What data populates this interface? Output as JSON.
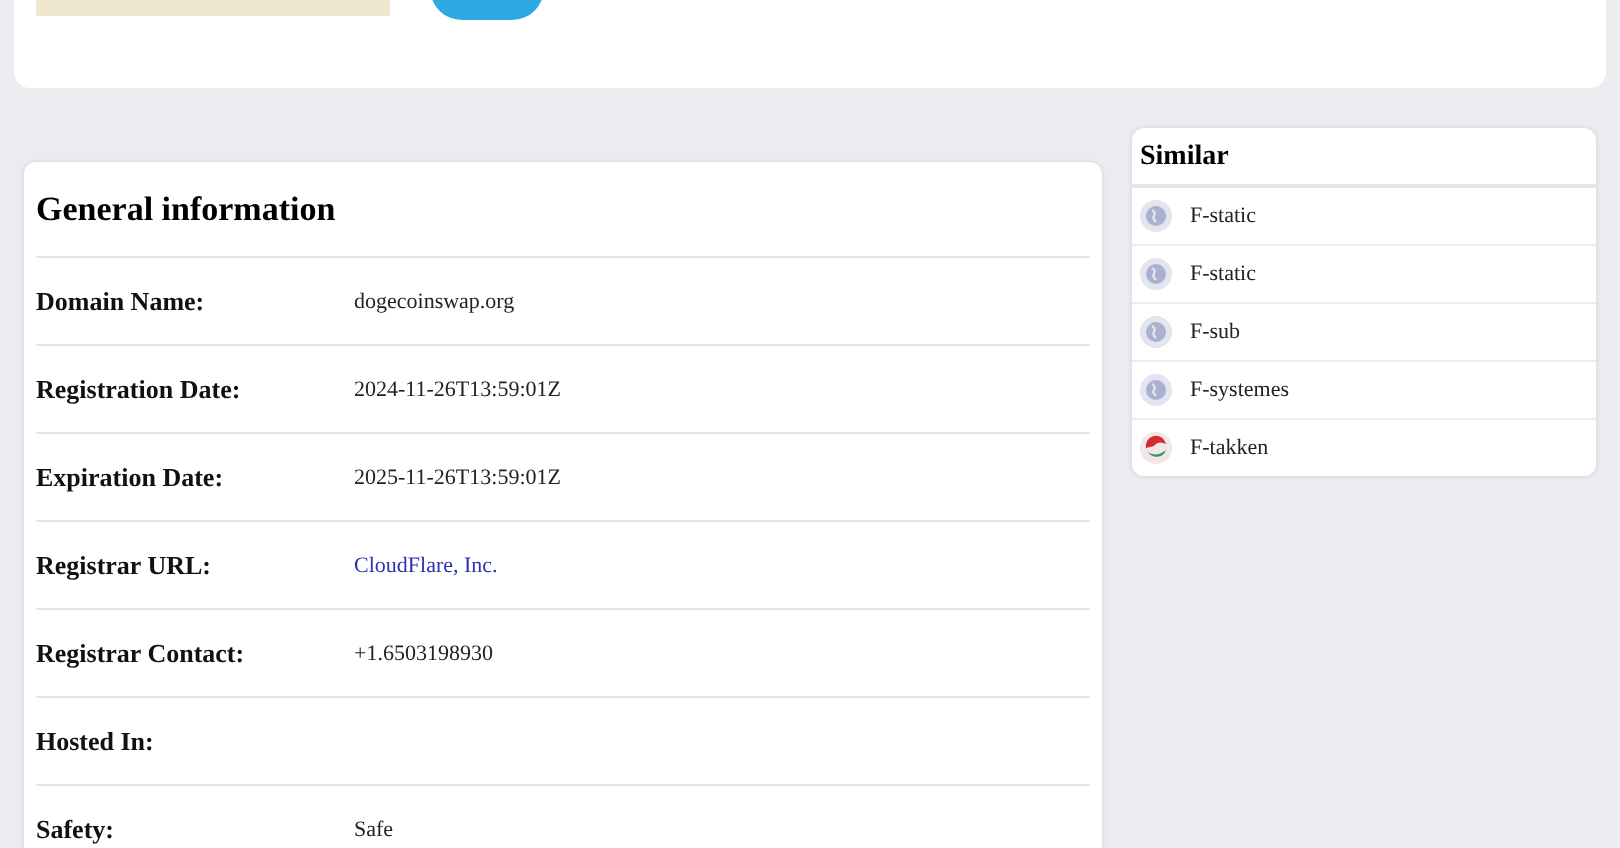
{
  "general_information": {
    "title": "General information",
    "rows": [
      {
        "label": "Domain Name:",
        "value": "dogecoinswap.org",
        "kind": "text"
      },
      {
        "label": "Registration Date:",
        "value": "2024-11-26T13:59:01Z",
        "kind": "text"
      },
      {
        "label": "Expiration Date:",
        "value": "2025-11-26T13:59:01Z",
        "kind": "text"
      },
      {
        "label": "Registrar URL:",
        "value": "CloudFlare, Inc.",
        "kind": "link"
      },
      {
        "label": "Registrar Contact:",
        "value": "+1.6503198930",
        "kind": "text"
      },
      {
        "label": "Hosted In:"
      },
      {
        "label": "Safety:",
        "value": "Safe",
        "kind": "text"
      }
    ]
  },
  "similar": {
    "title": "Similar",
    "items": [
      {
        "name": "F-static",
        "kind": "globe"
      },
      {
        "name": "F-static",
        "kind": "globe"
      },
      {
        "name": "F-sub",
        "kind": "globe"
      },
      {
        "name": "F-systemes",
        "kind": "globe"
      },
      {
        "name": "F-takken",
        "kind": "logo"
      }
    ]
  }
}
